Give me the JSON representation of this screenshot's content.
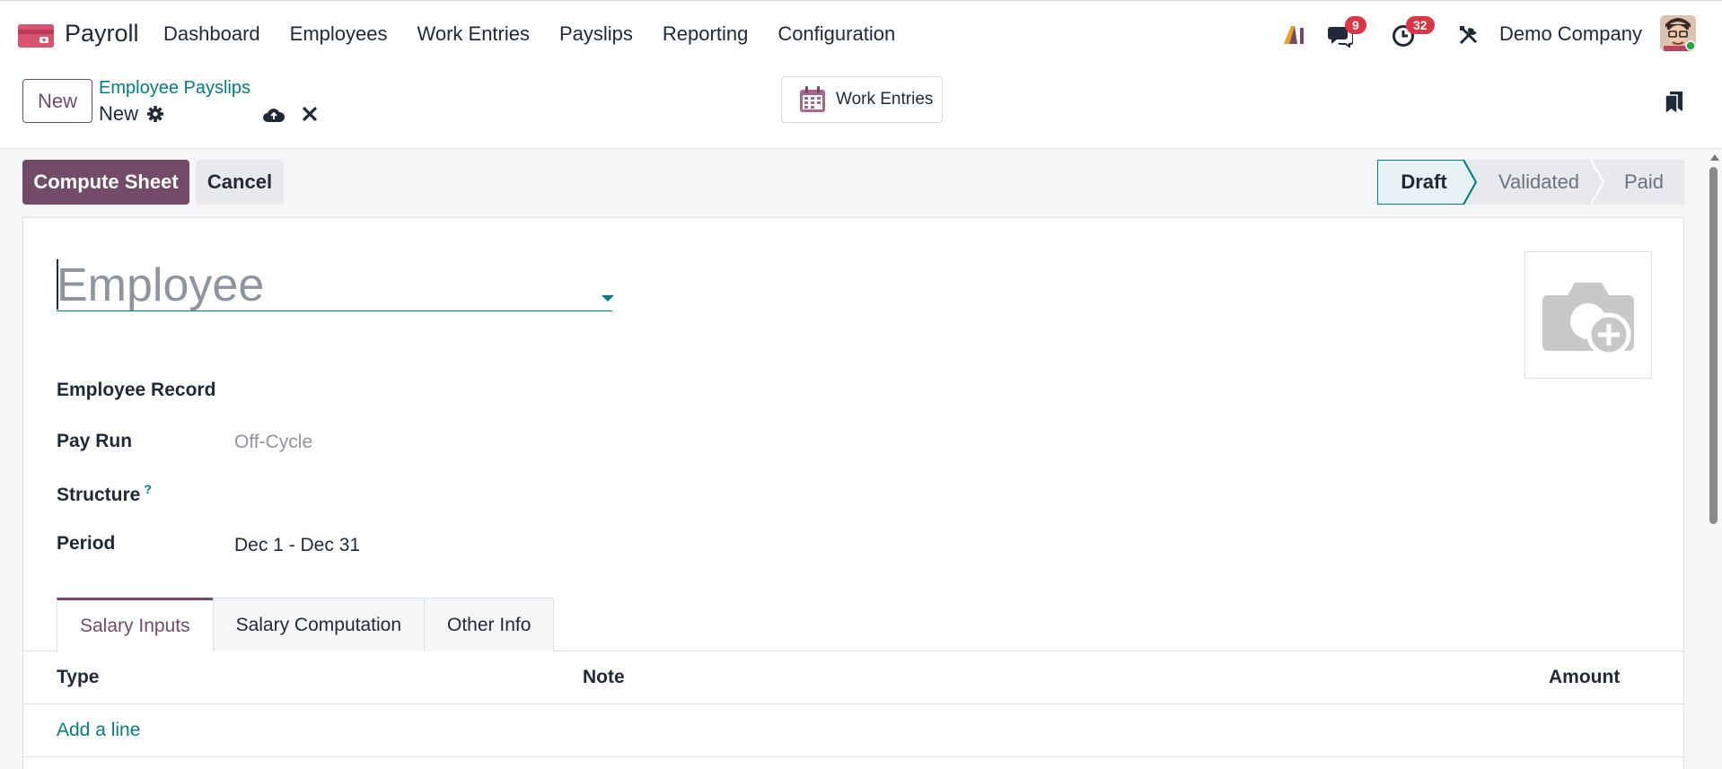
{
  "navbar": {
    "app_name": "Payroll",
    "menu": [
      "Dashboard",
      "Employees",
      "Work Entries",
      "Payslips",
      "Reporting",
      "Configuration"
    ],
    "messages_count": "9",
    "activities_count": "32",
    "company": "Demo Company"
  },
  "control": {
    "new_label": "New",
    "breadcrumb_parent": "Employee Payslips",
    "breadcrumb_current": "New",
    "work_entries_label": "Work Entries"
  },
  "actions": {
    "compute_label": "Compute Sheet",
    "cancel_label": "Cancel"
  },
  "status": {
    "steps": [
      "Draft",
      "Validated",
      "Paid"
    ],
    "active": "Draft"
  },
  "form": {
    "employee_placeholder": "Employee",
    "fields": {
      "employee_record_label": "Employee Record",
      "pay_run_label": "Pay Run",
      "pay_run_placeholder": "Off-Cycle",
      "structure_label": "Structure",
      "structure_help": "?",
      "period_label": "Period",
      "period_value": "Dec 1 - Dec 31"
    }
  },
  "tabs": [
    "Salary Inputs",
    "Salary Computation",
    "Other Info"
  ],
  "table": {
    "columns": [
      "Type",
      "Note",
      "Amount"
    ],
    "add_line": "Add a line"
  },
  "colors": {
    "primary": "#714b67",
    "accent": "#017e84",
    "badge": "#dc3545"
  }
}
